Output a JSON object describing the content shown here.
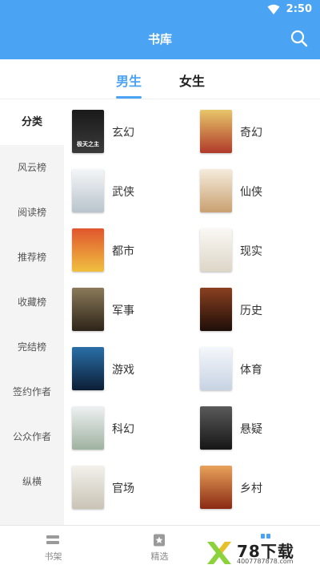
{
  "status_bar": {
    "time": "2:50"
  },
  "app_bar": {
    "title": "书库",
    "search_icon": "search-icon"
  },
  "tabs": [
    {
      "label": "男生",
      "active": true
    },
    {
      "label": "女生",
      "active": false
    }
  ],
  "sidebar": {
    "items": [
      {
        "label": "分类",
        "active": true
      },
      {
        "label": "风云榜"
      },
      {
        "label": "阅读榜"
      },
      {
        "label": "推荐榜"
      },
      {
        "label": "收藏榜"
      },
      {
        "label": "完结榜"
      },
      {
        "label": "签约作者"
      },
      {
        "label": "公众作者"
      },
      {
        "label": "纵横"
      }
    ]
  },
  "categories": [
    {
      "label": "玄幻",
      "cover_text": "极天之主",
      "cover_color": "#2a2a2a"
    },
    {
      "label": "奇幻",
      "cover_text": "",
      "cover_color": "#d9b04a"
    },
    {
      "label": "武侠",
      "cover_text": "",
      "cover_color": "#dfe6ea"
    },
    {
      "label": "仙侠",
      "cover_text": "",
      "cover_color": "#efe4d2"
    },
    {
      "label": "都市",
      "cover_text": "",
      "cover_color": "#c23a2a"
    },
    {
      "label": "现实",
      "cover_text": "",
      "cover_color": "#f2efe8"
    },
    {
      "label": "军事",
      "cover_text": "",
      "cover_color": "#6b5a3a"
    },
    {
      "label": "历史",
      "cover_text": "",
      "cover_color": "#5a3020"
    },
    {
      "label": "游戏",
      "cover_text": "",
      "cover_color": "#1d4b7a"
    },
    {
      "label": "体育",
      "cover_text": "",
      "cover_color": "#e8eef5"
    },
    {
      "label": "科幻",
      "cover_text": "",
      "cover_color": "#d8dde2"
    },
    {
      "label": "悬疑",
      "cover_text": "",
      "cover_color": "#3a3a3a"
    },
    {
      "label": "官场",
      "cover_text": "",
      "cover_color": "#e9e6df"
    },
    {
      "label": "乡村",
      "cover_text": "",
      "cover_color": "#c4552a"
    }
  ],
  "bottom_nav": [
    {
      "label": "书架",
      "icon": "bookshelf-icon",
      "active": false
    },
    {
      "label": "精选",
      "icon": "star-icon",
      "active": false
    },
    {
      "label": "",
      "icon": "library-icon",
      "active": true
    }
  ],
  "watermark": {
    "text": "78下载",
    "url": "4007787878.com"
  },
  "colors": {
    "accent": "#4aa3f3",
    "sidebar_bg": "#f4f4f4"
  }
}
